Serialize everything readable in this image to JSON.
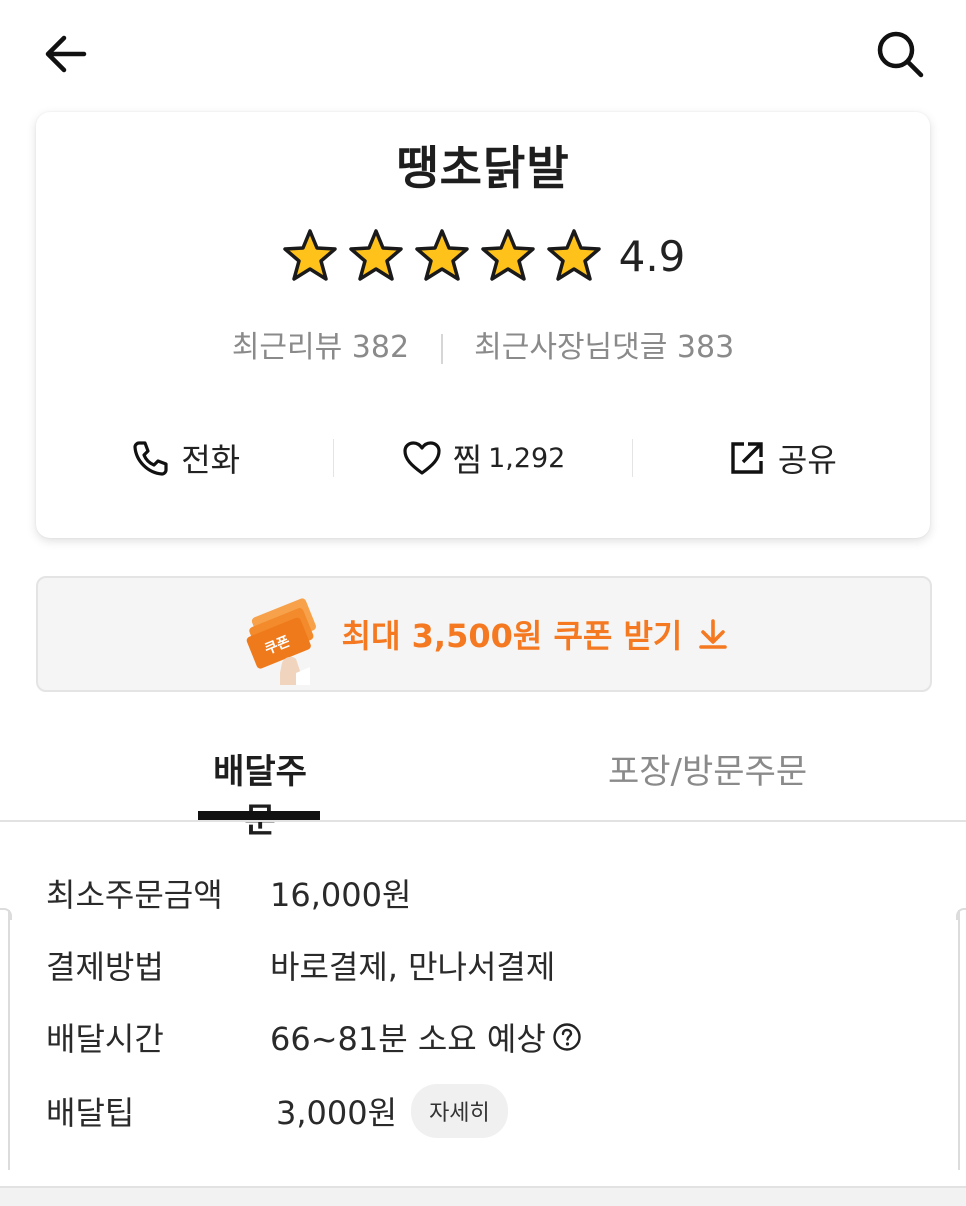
{
  "header": {
    "back_icon": "arrow-left-icon",
    "search_icon": "search-icon"
  },
  "store": {
    "name": "땡초닭발",
    "rating": "4.9",
    "stars": 5,
    "recent_reviews_label": "최근리뷰",
    "recent_reviews_count": "382",
    "recent_owner_replies_label": "최근사장님댓글",
    "recent_owner_replies_count": "383"
  },
  "actions": {
    "call_label": "전화",
    "favorite_label": "찜",
    "favorite_count": "1,292",
    "share_label": "공유"
  },
  "coupon": {
    "badge_text": "쿠폰",
    "label": "최대 3,500원 쿠폰 받기",
    "accent_color": "#f47920"
  },
  "tabs": [
    {
      "label": "배달주문",
      "active": true
    },
    {
      "label": "포장/방문주문",
      "active": false
    }
  ],
  "info": {
    "min_order_label": "최소주문금액",
    "min_order_value": "16,000원",
    "payment_label": "결제방법",
    "payment_value": "바로결제, 만나서결제",
    "delivery_time_label": "배달시간",
    "delivery_time_value": "66~81분 소요 예상",
    "delivery_tip_label": "배달팁",
    "delivery_tip_value": "3,000원",
    "detail_button": "자세히"
  }
}
